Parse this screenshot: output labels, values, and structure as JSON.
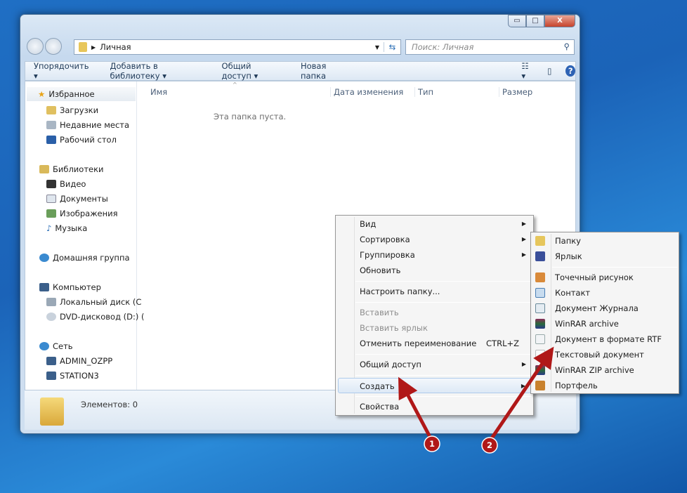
{
  "window": {
    "controls": {
      "minimize": "▭",
      "maximize": "□",
      "close": "X"
    },
    "address": {
      "path": "Личная"
    },
    "search_placeholder": "Поиск: Личная"
  },
  "toolbar": {
    "organize": "Упорядочить ▾",
    "add_library": "Добавить в библиотеку ▾",
    "share": "Общий доступ ▾",
    "new_folder": "Новая папка"
  },
  "sidebar": {
    "favorites": "Избранное",
    "downloads": "Загрузки",
    "recent": "Недавние места",
    "desktop": "Рабочий стол",
    "libraries": "Библиотеки",
    "video": "Видео",
    "documents": "Документы",
    "images": "Изображения",
    "music": "Музыка",
    "homegroup": "Домашняя группа",
    "computer": "Компьютер",
    "local_disk": "Локальный диск (C",
    "dvd": "DVD-дисковод (D:) (",
    "network": "Сеть",
    "admin": "ADMIN_OZPP",
    "station": "STATION3"
  },
  "columns": [
    "Имя",
    "Дата изменения",
    "Тип",
    "Размер"
  ],
  "empty_text": "Эта папка пуста.",
  "status": "Элементов: 0",
  "context_menu": [
    {
      "label": "Вид",
      "submenu": true
    },
    {
      "label": "Сортировка",
      "submenu": true
    },
    {
      "label": "Группировка",
      "submenu": true
    },
    {
      "label": "Обновить"
    },
    {
      "label": "Настроить папку..."
    },
    {
      "label": "Вставить",
      "disabled": true
    },
    {
      "label": "Вставить ярлык",
      "disabled": true
    },
    {
      "label": "Отменить переименование",
      "shortcut": "CTRL+Z"
    },
    {
      "label": "Общий доступ",
      "submenu": true
    },
    {
      "label": "Создать",
      "submenu": true,
      "highlighted": true
    },
    {
      "label": "Свойства"
    }
  ],
  "submenu": [
    {
      "label": "Папку",
      "icon": "folder-icon"
    },
    {
      "label": "Ярлык",
      "icon": "shortcut-icon"
    },
    {
      "label": "Точечный рисунок",
      "icon": "bitmap-icon"
    },
    {
      "label": "Контакт",
      "icon": "contact-icon"
    },
    {
      "label": "Документ Журнала",
      "icon": "journal-icon"
    },
    {
      "label": "WinRAR archive",
      "icon": "winrar-icon"
    },
    {
      "label": "Документ в формате RTF",
      "icon": "rtf-icon"
    },
    {
      "label": "Текстовый документ",
      "icon": "text-document-icon"
    },
    {
      "label": "WinRAR ZIP archive",
      "icon": "winrar-zip-icon"
    },
    {
      "label": "Портфель",
      "icon": "briefcase-icon"
    }
  ],
  "annotations": {
    "step1": "1",
    "step2": "2"
  },
  "colors": {
    "arrow": "#b01818",
    "highlight": "#dde9f6"
  }
}
